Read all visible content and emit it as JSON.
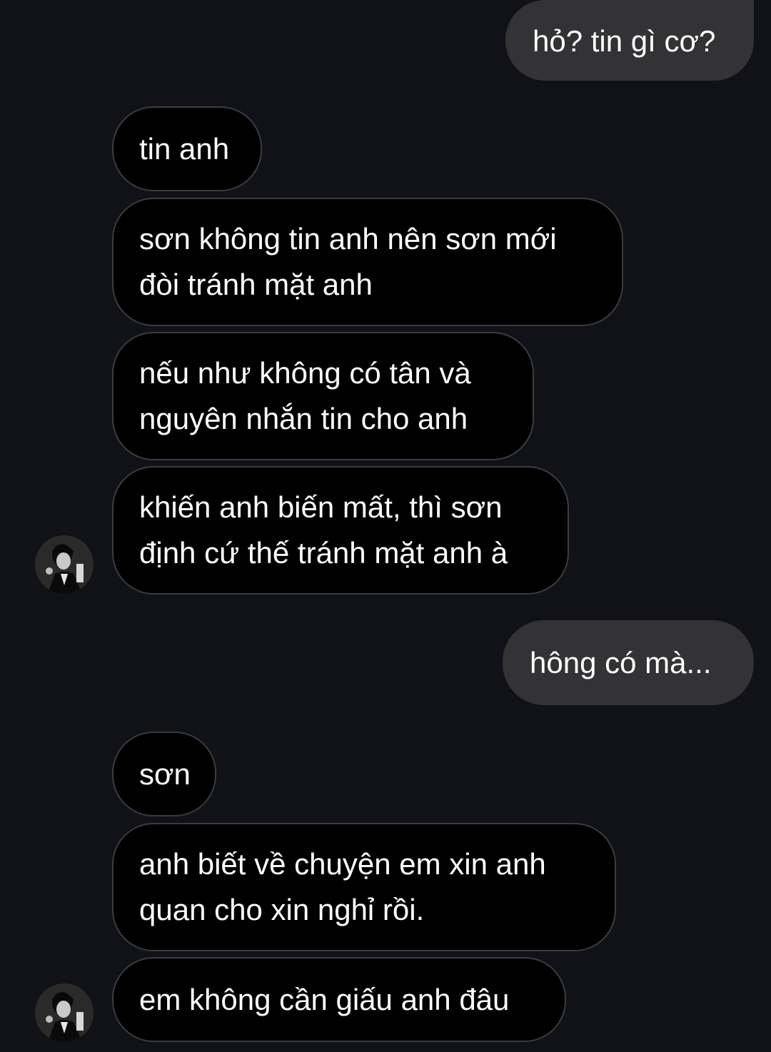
{
  "conversation": {
    "messages": [
      {
        "sender": "me",
        "text": "hỏ? tin gì cơ?"
      },
      {
        "sender": "other",
        "text": "tin anh"
      },
      {
        "sender": "other",
        "text": "sơn không tin anh nên sơn mới đòi tránh mặt anh"
      },
      {
        "sender": "other",
        "text": "nếu như không có tân và nguyên nhắn tin cho anh"
      },
      {
        "sender": "other",
        "text": "khiến anh biến mất, thì sơn định cứ thế tránh mặt anh à"
      },
      {
        "sender": "me",
        "text": "hông có mà..."
      },
      {
        "sender": "other",
        "text": "sơn"
      },
      {
        "sender": "other",
        "text": "anh biết về chuyện em xin anh quan cho xin nghỉ rồi."
      },
      {
        "sender": "other",
        "text": "em không cần giấu anh đâu"
      }
    ],
    "avatar_icon": "person-photo-icon"
  },
  "colors": {
    "background": "#111217",
    "incoming_bubble": "#000000",
    "incoming_border": "#3b3c42",
    "outgoing_bubble": "#333335",
    "text": "#ffffff"
  }
}
